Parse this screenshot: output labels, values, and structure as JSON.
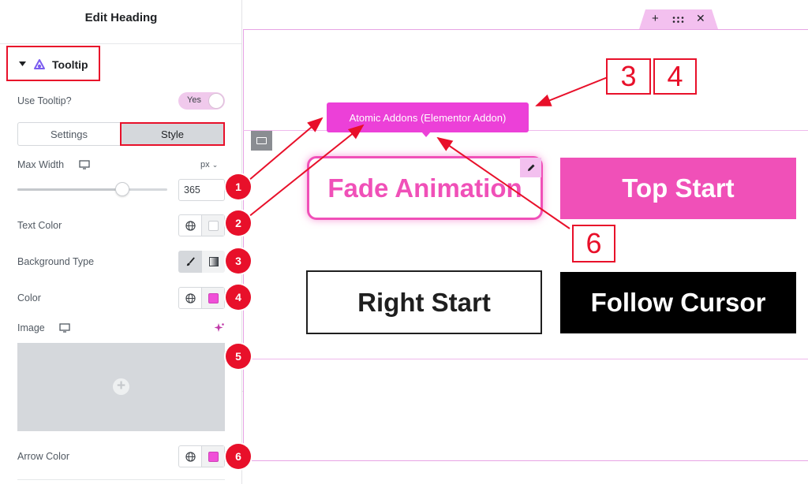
{
  "panel": {
    "title": "Edit Heading",
    "section_title": "Tooltip",
    "use_tooltip_label": "Use Tooltip?",
    "use_tooltip_value": "Yes",
    "tabs": [
      "Settings",
      "Style"
    ],
    "max_width_label": "Max Width",
    "max_width_unit": "px",
    "max_width_value": "365",
    "max_width_fraction": 0.7,
    "text_color_label": "Text Color",
    "background_type_label": "Background Type",
    "color_label": "Color",
    "image_label": "Image",
    "arrow_color_label": "Arrow Color"
  },
  "canvas": {
    "tooltip_text": "Atomic Addons (Elementor Addon)",
    "buttons": [
      "Fade Animation",
      "Top Start",
      "Right Start",
      "Follow Cursor"
    ]
  },
  "annotations": {
    "badges": [
      "1",
      "2",
      "3",
      "4",
      "5",
      "6"
    ],
    "callouts": [
      "3",
      "4",
      "6"
    ]
  },
  "colors": {
    "accent_pink": "#f050b8",
    "tooltip_bg": "#ec40d8",
    "annotation_red": "#e8102a",
    "image_placeholder": "#d5d8dc"
  }
}
